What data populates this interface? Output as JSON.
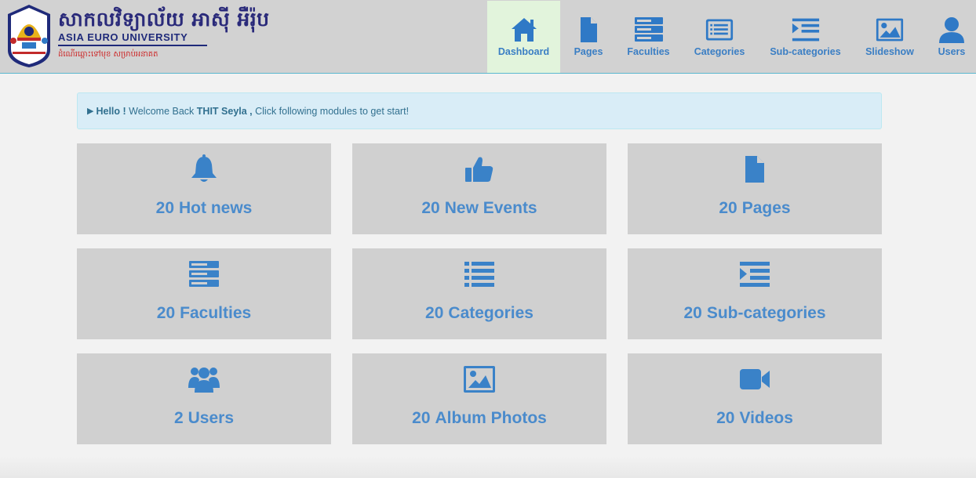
{
  "brand": {
    "khmer_name": "សាកលវិទ្យាល័យ អាស៊ី អឺរ៉ុប",
    "name": "ASIA EURO UNIVERSITY",
    "motto": "ដំណើរឆ្ពោះទៅមុខ សម្រាប់អនាគត",
    "logo_text": "ASIA EURO UNIVERSITY"
  },
  "nav": [
    {
      "label": "Dashboard",
      "icon": "home-icon",
      "active": true
    },
    {
      "label": "Pages",
      "icon": "file-icon",
      "active": false
    },
    {
      "label": "Faculties",
      "icon": "server-icon",
      "active": false
    },
    {
      "label": "Categories",
      "icon": "list-alt-icon",
      "active": false
    },
    {
      "label": "Sub-categories",
      "icon": "indent-icon",
      "active": false
    },
    {
      "label": "Slideshow",
      "icon": "picture-icon",
      "active": false
    },
    {
      "label": "Users",
      "icon": "user-icon",
      "active": false
    }
  ],
  "alert": {
    "hello": "Hello !",
    "welcome": "Welcome Back",
    "user": "THIT Seyla ,",
    "message": "Click following modules to get start!"
  },
  "tiles": [
    {
      "count": "20",
      "label": "Hot news",
      "icon": "bell-icon"
    },
    {
      "count": "20",
      "label": "New Events",
      "icon": "thumbs-up-icon"
    },
    {
      "count": "20",
      "label": "Pages",
      "icon": "file-icon"
    },
    {
      "count": "20",
      "label": "Faculties",
      "icon": "server-icon"
    },
    {
      "count": "20",
      "label": "Categories",
      "icon": "list-icon"
    },
    {
      "count": "20",
      "label": "Sub-categories",
      "icon": "indent-icon"
    },
    {
      "count": "2",
      "label": "Users",
      "icon": "users-icon"
    },
    {
      "count": "20",
      "label": "Album Photos",
      "icon": "picture-icon"
    },
    {
      "count": "20",
      "label": "Videos",
      "icon": "video-camera-icon"
    }
  ],
  "colors": {
    "accent": "#3a82c8",
    "topbar": "#d2d2d2",
    "active_nav": "#e2f4dc",
    "alert_bg": "#d9edf7",
    "alert_text": "#31708f",
    "tile_bg": "#d0d0d0"
  }
}
